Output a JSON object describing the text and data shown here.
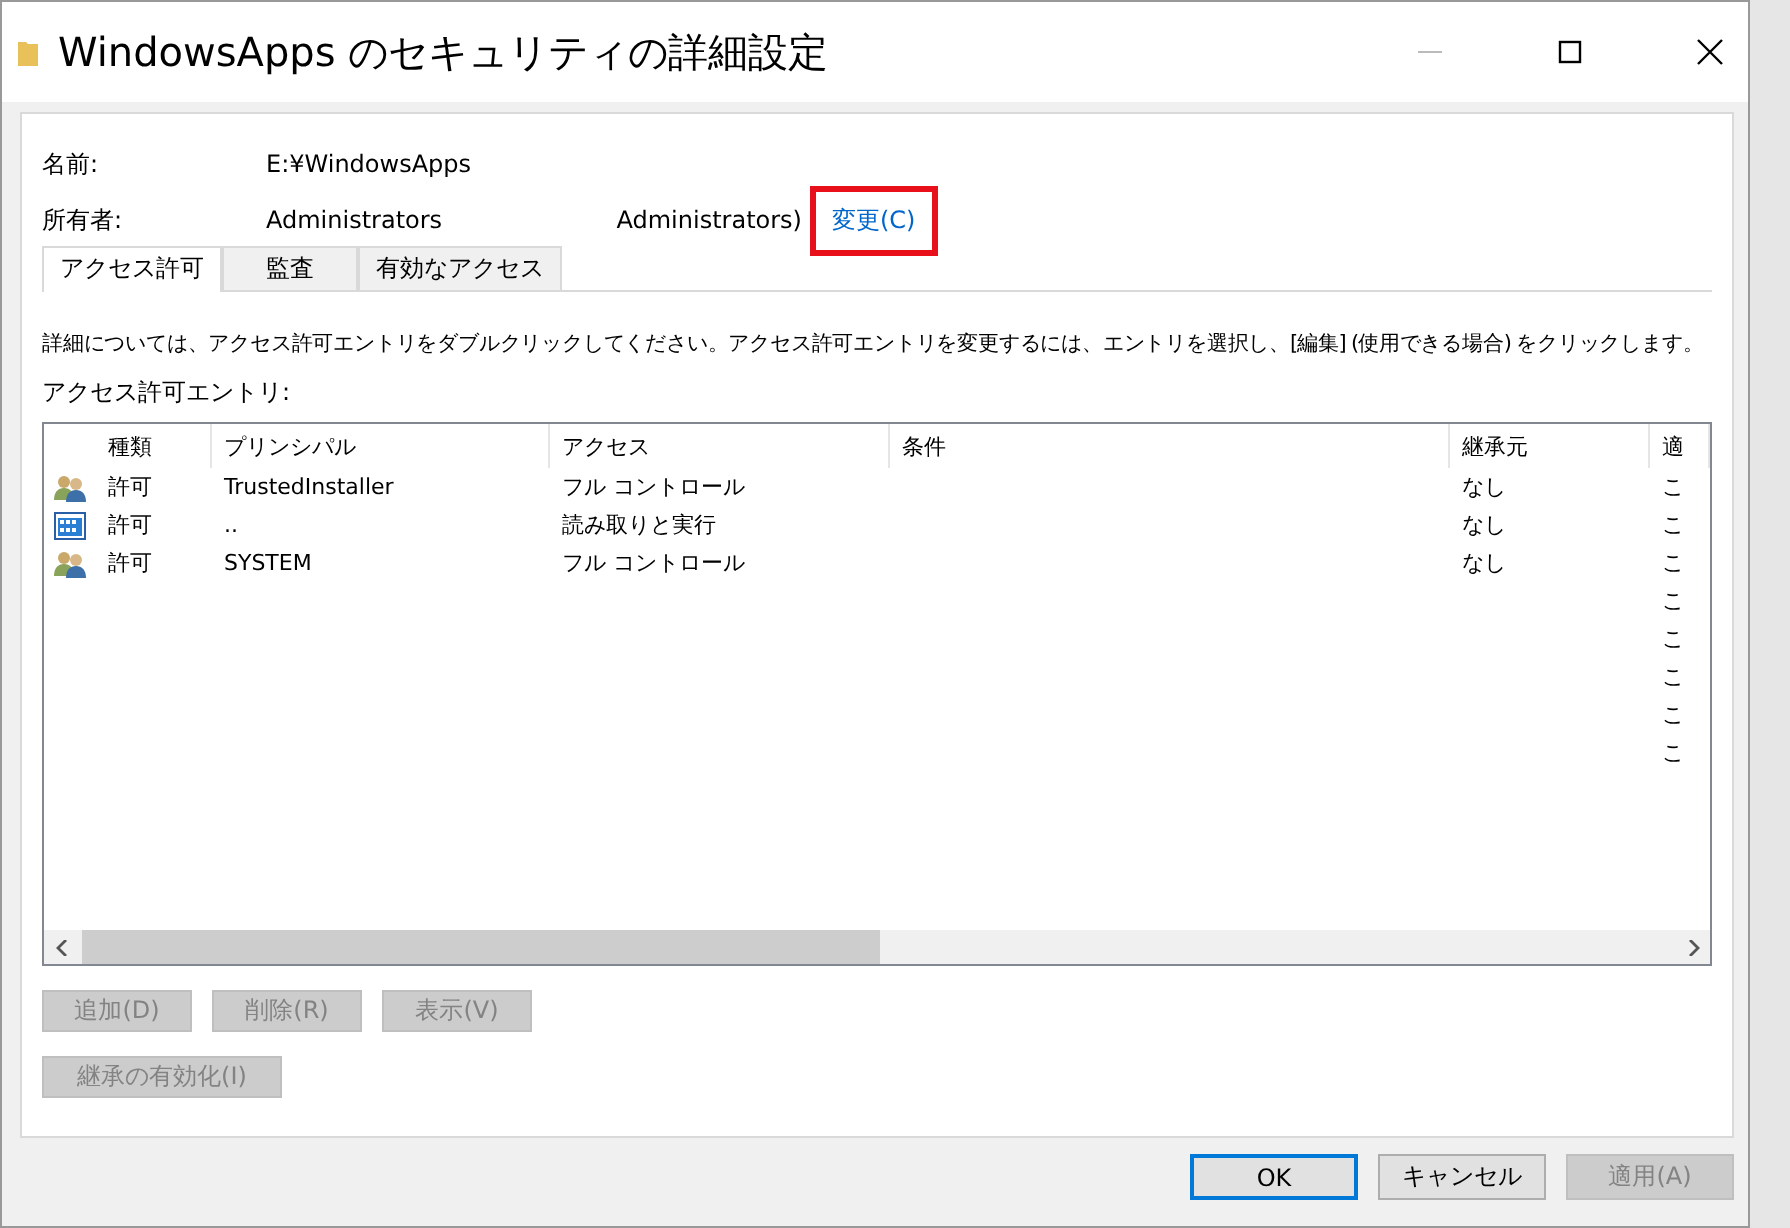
{
  "window": {
    "title": "WindowsApps のセキュリティの詳細設定"
  },
  "name_row": {
    "label": "名前:",
    "value": "E:¥WindowsApps"
  },
  "owner_row": {
    "label": "所有者:",
    "value": "Administrators",
    "value_2": "Administrators)",
    "link": "変更(C)",
    "highlighted": true
  },
  "tabs": [
    {
      "label": "アクセス許可",
      "selected": true
    },
    {
      "label": "監査",
      "selected": false
    },
    {
      "label": "有効なアクセス",
      "selected": false
    }
  ],
  "description": "詳細については、アクセス許可エントリをダブルクリックしてください。アクセス許可エントリを変更するには、エントリを選択し、[編集] (使用できる場合) をクリックします。",
  "list_label": "アクセス許可エントリ:",
  "table": {
    "columns": [
      "種類",
      "プリンシパル",
      "アクセス",
      "条件",
      "継承元",
      "適"
    ],
    "rows": [
      {
        "kind": "group",
        "type": "許可",
        "principal": "TrustedInstaller",
        "access": "フル コントロール",
        "inherited": "なし",
        "column_6": "こ"
      },
      {
        "kind": "app",
        "type": "許可",
        "principal": "..",
        "access": "読み取りと実行",
        "inherited": "なし",
        "column_6": "こ"
      },
      {
        "kind": "group",
        "type": "許可",
        "principal": "SYSTEM",
        "access": "フル コントロール",
        "inherited": "なし",
        "column_6": "こ"
      },
      {
        "kind": "none",
        "column_6": "こ"
      },
      {
        "kind": "none",
        "column_6": "こ"
      },
      {
        "kind": "none",
        "column_6": "こ"
      },
      {
        "kind": "none",
        "column_6": "こ"
      },
      {
        "kind": "none",
        "column_6": "こ"
      }
    ]
  },
  "action_buttons": [
    {
      "label": "追加(D)",
      "disabled": true
    },
    {
      "label": "削除(R)",
      "disabled": true
    },
    {
      "label": "表示(V)",
      "disabled": true
    }
  ],
  "inheritance_button": {
    "label": "継承の有効化(I)",
    "disabled": true
  },
  "footer_buttons": [
    {
      "label": "OK",
      "disabled": false,
      "default": true
    },
    {
      "label": "キャンセル",
      "disabled": false,
      "default": false
    },
    {
      "label": "適用(A)",
      "disabled": true,
      "default": false
    }
  ]
}
